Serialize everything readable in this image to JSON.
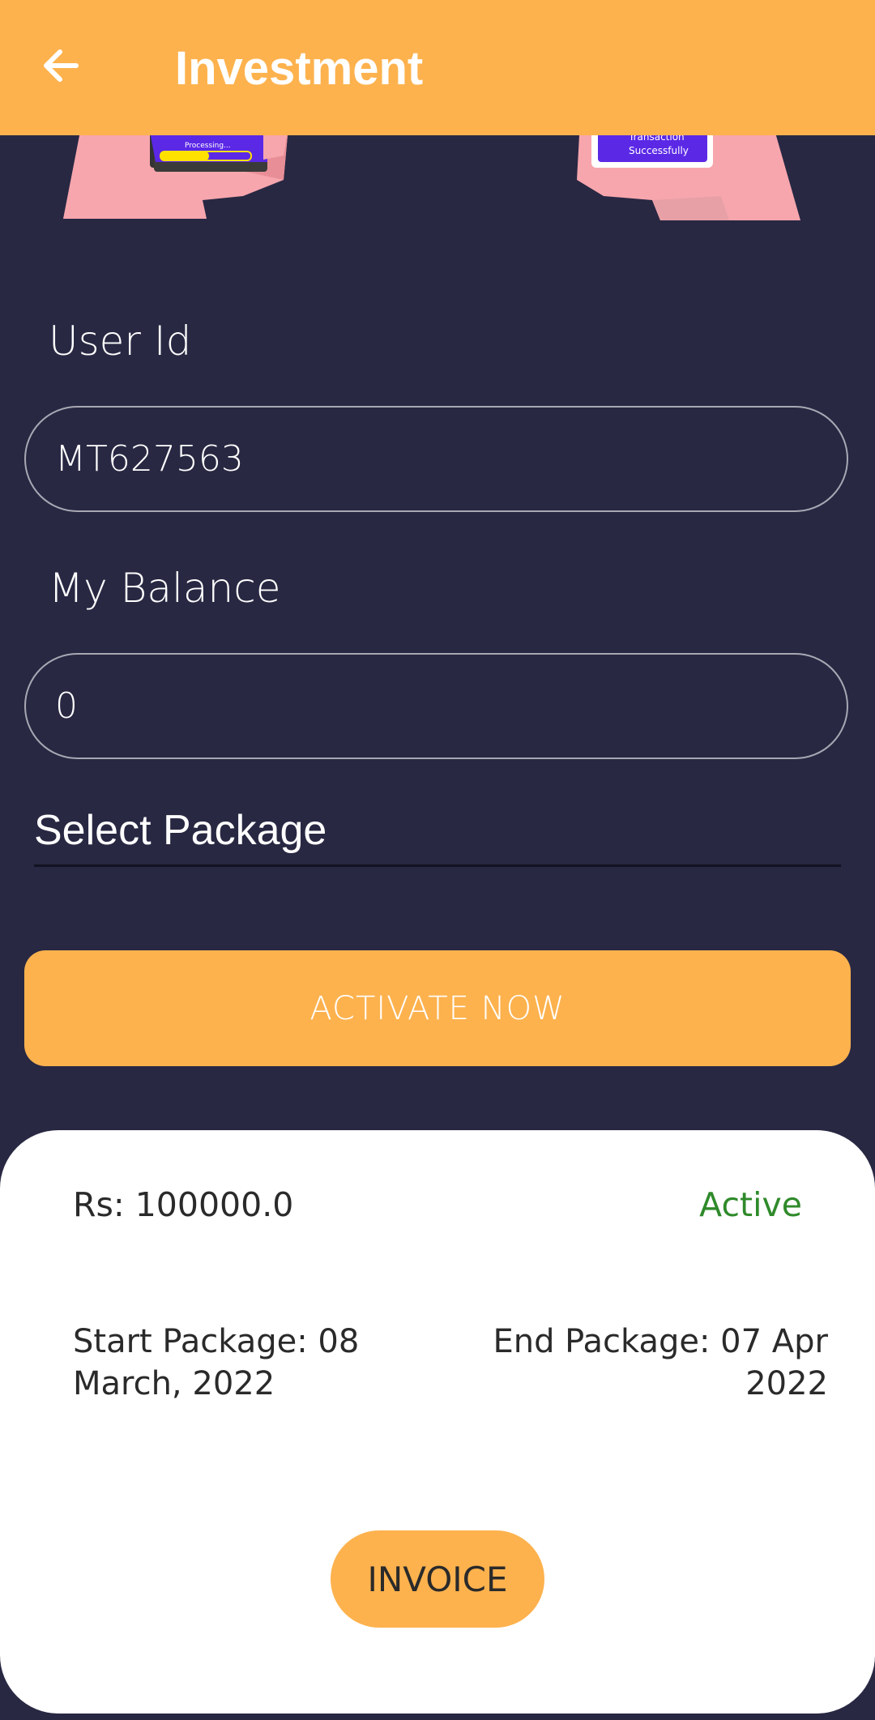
{
  "appbar": {
    "title": "Investment"
  },
  "hero": {
    "left_phone_text": "Processing...",
    "right_phone_text_1": "Transaction",
    "right_phone_text_2": "Successfully"
  },
  "form": {
    "user_id_label": "User Id",
    "user_id_value": "MT627563",
    "balance_label": "My Balance",
    "balance_value": "0",
    "select_package_label": "Select Package",
    "activate_button": "ACTIVATE NOW"
  },
  "package_card": {
    "amount": "Rs: 100000.0",
    "status": "Active",
    "start": "Start Package: 08 March, 2022",
    "end": "End Package: 07 Apr 2022",
    "invoice_button": "INVOICE"
  },
  "colors": {
    "accent": "#FDB24E",
    "background": "#282843",
    "active_status": "#2f8a2a"
  }
}
